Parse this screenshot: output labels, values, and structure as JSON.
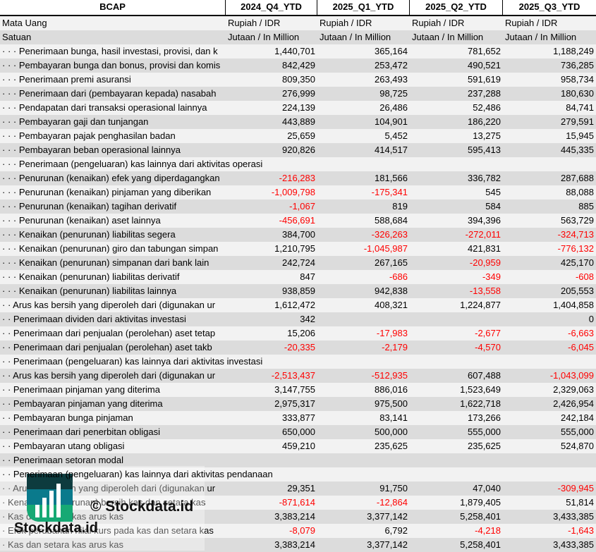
{
  "header": {
    "title": "BCAP",
    "periods": [
      "2024_Q4_YTD",
      "2025_Q1_YTD",
      "2025_Q2_YTD",
      "2025_Q3_YTD"
    ]
  },
  "currency": {
    "label": "Mata Uang",
    "values": [
      "Rupiah / IDR",
      "Rupiah / IDR",
      "Rupiah / IDR",
      "Rupiah / IDR"
    ]
  },
  "unit": {
    "label": "Satuan",
    "values": [
      "Jutaan / In Million",
      "Jutaan / In Million",
      "Jutaan / In Million",
      "Jutaan / In Million"
    ]
  },
  "colors": {
    "negative": "#ff0000",
    "row_light": "#f2f2f2",
    "row_dark": "#dcdcdc"
  },
  "rows": [
    {
      "label": "· · · Penerimaan bunga, hasil investasi, provisi, dan k",
      "values": [
        "1,440,701",
        "365,164",
        "781,652",
        "1,188,249"
      ]
    },
    {
      "label": "· · · Pembayaran bunga dan bonus, provisi dan komis",
      "values": [
        "842,429",
        "253,472",
        "490,521",
        "736,285"
      ]
    },
    {
      "label": "· · · Penerimaan premi asuransi",
      "values": [
        "809,350",
        "263,493",
        "591,619",
        "958,734"
      ]
    },
    {
      "label": "· · · Penerimaan dari (pembayaran kepada) nasabah",
      "values": [
        "276,999",
        "98,725",
        "237,288",
        "180,630"
      ]
    },
    {
      "label": "· · · Pendapatan dari transaksi operasional lainnya",
      "values": [
        "224,139",
        "26,486",
        "52,486",
        "84,741"
      ]
    },
    {
      "label": "· · · Pembayaran gaji dan tunjangan",
      "values": [
        "443,889",
        "104,901",
        "186,220",
        "279,591"
      ]
    },
    {
      "label": "· · · Pembayaran pajak penghasilan badan",
      "values": [
        "25,659",
        "5,452",
        "13,275",
        "15,945"
      ]
    },
    {
      "label": "· · · Pembayaran beban operasional lainnya",
      "values": [
        "920,826",
        "414,517",
        "595,413",
        "445,335"
      ]
    },
    {
      "label": "· · · Penerimaan (pengeluaran) kas lainnya dari aktivitas operasi",
      "values": [
        "",
        "",
        "",
        ""
      ]
    },
    {
      "label": "· · · Penurunan (kenaikan) efek yang diperdagangkan",
      "values": [
        "-216,283",
        "181,566",
        "336,782",
        "287,688"
      ]
    },
    {
      "label": "· · · Penurunan (kenaikan) pinjaman yang diberikan",
      "values": [
        "-1,009,798",
        "-175,341",
        "545",
        "88,088"
      ]
    },
    {
      "label": "· · · Penurunan (kenaikan) tagihan derivatif",
      "values": [
        "-1,067",
        "819",
        "584",
        "885"
      ]
    },
    {
      "label": "· · · Penurunan (kenaikan) aset lainnya",
      "values": [
        "-456,691",
        "588,684",
        "394,396",
        "563,729"
      ]
    },
    {
      "label": "· · · Kenaikan (penurunan) liabilitas segera",
      "values": [
        "384,700",
        "-326,263",
        "-272,011",
        "-324,713"
      ]
    },
    {
      "label": "· · · Kenaikan (penurunan) giro dan tabungan simpan",
      "values": [
        "1,210,795",
        "-1,045,987",
        "421,831",
        "-776,132"
      ]
    },
    {
      "label": "· · · Kenaikan (penurunan) simpanan dari bank lain",
      "values": [
        "242,724",
        "267,165",
        "-20,959",
        "425,170"
      ]
    },
    {
      "label": "· · · Kenaikan (penurunan) liabilitas derivatif",
      "values": [
        "847",
        "-686",
        "-349",
        "-608"
      ]
    },
    {
      "label": "· · · Kenaikan (penurunan) liabilitas lainnya",
      "values": [
        "938,859",
        "942,838",
        "-13,558",
        "205,553"
      ]
    },
    {
      "label": "· · Arus kas bersih yang diperoleh dari (digunakan ur",
      "values": [
        "1,612,472",
        "408,321",
        "1,224,877",
        "1,404,858"
      ]
    },
    {
      "label": "· · Penerimaan dividen dari aktivitas investasi",
      "values": [
        "342",
        "",
        "",
        "0"
      ]
    },
    {
      "label": "· · Penerimaan dari penjualan (perolehan) aset tetap",
      "values": [
        "15,206",
        "-17,983",
        "-2,677",
        "-6,663"
      ]
    },
    {
      "label": "· · Penerimaan dari penjualan (perolehan) aset takb",
      "values": [
        "-20,335",
        "-2,179",
        "-4,570",
        "-6,045"
      ]
    },
    {
      "label": "· · Penerimaan (pengeluaran) kas lainnya dari aktivitas investasi",
      "values": [
        "",
        "",
        "",
        ""
      ]
    },
    {
      "label": "· · Arus kas bersih yang diperoleh dari (digunakan ur",
      "values": [
        "-2,513,437",
        "-512,935",
        "607,488",
        "-1,043,099"
      ]
    },
    {
      "label": "· · Penerimaan pinjaman yang diterima",
      "values": [
        "3,147,755",
        "886,016",
        "1,523,649",
        "2,329,063"
      ]
    },
    {
      "label": "· · Pembayaran pinjaman yang diterima",
      "values": [
        "2,975,317",
        "975,500",
        "1,622,718",
        "2,426,954"
      ]
    },
    {
      "label": "· · Pembayaran bunga pinjaman",
      "values": [
        "333,877",
        "83,141",
        "173,266",
        "242,184"
      ]
    },
    {
      "label": "· · Penerimaan dari penerbitan obligasi",
      "values": [
        "650,000",
        "500,000",
        "555,000",
        "555,000"
      ]
    },
    {
      "label": "· · Pembayaran utang obligasi",
      "values": [
        "459,210",
        "235,625",
        "235,625",
        "524,870"
      ]
    },
    {
      "label": "· · Penerimaan setoran modal",
      "values": [
        "",
        "",
        "",
        ""
      ]
    },
    {
      "label": "· · Penerimaan (pengeluaran) kas lainnya dari aktivitas pendanaan",
      "values": [
        "",
        "",
        "",
        ""
      ]
    },
    {
      "label": "· · Arus kas bersih yang diperoleh dari (digunakan ur",
      "values": [
        "29,351",
        "91,750",
        "47,040",
        "-309,945"
      ]
    },
    {
      "label": "· Kenaikan (penurunan) bersih kas dan setara kas",
      "values": [
        "-871,614",
        "-12,864",
        "1,879,405",
        "51,814"
      ]
    },
    {
      "label": "· Kas dan setara kas arus kas",
      "values": [
        "3,383,214",
        "3,377,142",
        "5,258,401",
        "3,433,385"
      ]
    },
    {
      "label": "· Efek perubahan nilai kurs pada kas dan setara kas",
      "values": [
        "-8,079",
        "6,792",
        "-4,218",
        "-1,643"
      ]
    },
    {
      "label": "· Kas dan setara kas arus kas",
      "values": [
        "3,383,214",
        "3,377,142",
        "5,258,401",
        "3,433,385"
      ]
    }
  ],
  "watermark": {
    "copyright": "© Stockdata.id",
    "brand": "Stockdata.id",
    "logo_colors": [
      "#0d3b3e",
      "#0a7a8c",
      "#16a974"
    ]
  }
}
